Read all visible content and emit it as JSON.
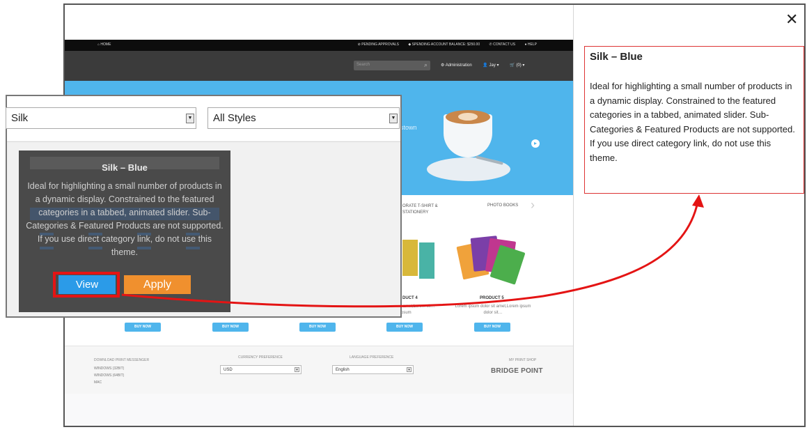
{
  "modal": {
    "close": "✕"
  },
  "store": {
    "topbar": {
      "home": "⌂ HOME",
      "links": [
        "⊘ PENDING APPROVALS",
        "◆ SPENDING ACCOUNT BALANCE: $250.00",
        "✆ CONTACT US",
        "● HELP"
      ]
    },
    "header": {
      "search_placeholder": "Search",
      "search_icon": "magnifier-icon",
      "nav": [
        "⚙ Administration",
        "👤 Jay ▾",
        "🛒 (0) ▾"
      ]
    },
    "banner": {
      "text": "stown",
      "next_icon": "chevron-right-icon"
    },
    "categories": [
      "ORATE T-SHIRT & STATIONERY",
      "PHOTO BOOKS"
    ],
    "products": [
      {
        "title": "DUCT 4",
        "desc": "dolor sit amet,Lorem sit… Lorem ipsum"
      },
      {
        "title": "PRODUCT 5",
        "desc": "Lorem ipsum dolor sit amet,Lorem ipsum dolor sit…"
      }
    ],
    "buy_label": "BUY NOW",
    "footer": {
      "download_label": "DOWNLOAD PRINT MESSENGER",
      "downloads": [
        "WINDOWS (32BIT)",
        "WINDOWS (64BIT)",
        "MAC"
      ],
      "currency_label": "CURRENCY PREFERENCE",
      "currency_value": "USD",
      "language_label": "LANGUAGE PREFERENCE",
      "language_value": "English",
      "shop_label": "MY PRINT SHOP",
      "shop_name": "BRIDGE POINT"
    }
  },
  "info_panel": {
    "title": "Silk – Blue",
    "description": "Ideal for highlighting a small number of products in a dynamic display. Constrained to the featured categories in a tabbed, animated slider. Sub-Categories & Featured Products are not supported. If you use direct category link, do not use this theme."
  },
  "zoom": {
    "theme_select": "Silk",
    "style_select": "All Styles",
    "card_title": "Silk – Blue",
    "card_description": "Ideal for highlighting a small number of products in a dynamic display. Constrained to the featured categories in a tabbed, animated slider. Sub-Categories & Featured Products are not supported. If you use direct category link, do not use this theme.",
    "view_label": "View",
    "apply_label": "Apply"
  },
  "colors": {
    "accent_blue": "#2b9be8",
    "apply_orange": "#f0902e",
    "highlight_red": "#e41414",
    "banner_blue": "#4fb5ec"
  }
}
